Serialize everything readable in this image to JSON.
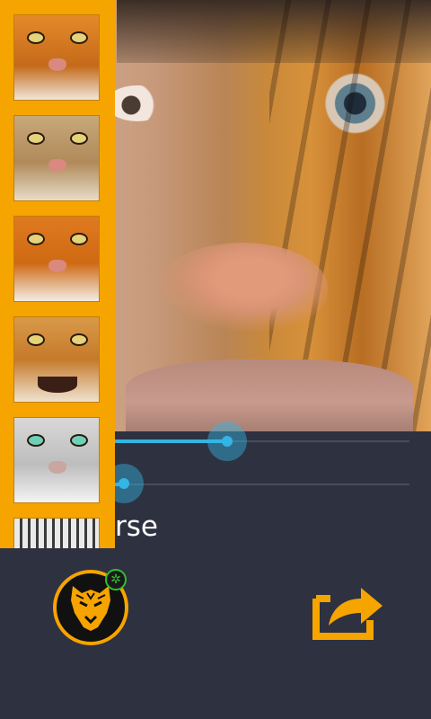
{
  "screen": {
    "background_color": "#2e3140",
    "accent_color": "#f6a400",
    "slider_color": "#33b5e5"
  },
  "photo": {
    "description_icon": "face-with-tiger-overlay"
  },
  "sidebar": {
    "thumbnails": [
      {
        "name": "tiger-face-1"
      },
      {
        "name": "tiger-face-2"
      },
      {
        "name": "tiger-face-3"
      },
      {
        "name": "tiger-roaring"
      },
      {
        "name": "white-tiger"
      },
      {
        "name": "white-tiger-partial"
      }
    ]
  },
  "sliders": {
    "blend": {
      "value_fraction": 0.38
    },
    "second": {
      "value_fraction": 0.03
    }
  },
  "option": {
    "label": "rse"
  },
  "actions": {
    "logo_icon": "tiger-logo-icon",
    "badge_glyph": "✲",
    "share_icon": "share-icon"
  }
}
